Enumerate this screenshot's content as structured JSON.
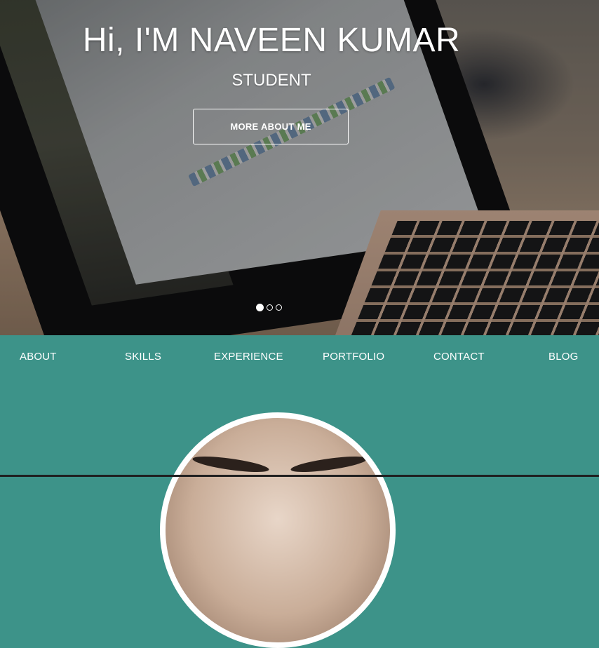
{
  "hero": {
    "title": "Hi, I'M NAVEEN KUMAR",
    "subtitle": "STUDENT",
    "button_label": "MORE ABOUT ME",
    "slides": {
      "count": 3,
      "active": 1
    }
  },
  "nav": {
    "items": [
      "ABOUT",
      "SKILLS",
      "EXPERIENCE",
      "PORTFOLIO",
      "CONTACT",
      "BLOG"
    ]
  },
  "colors": {
    "nav_background": "#3d9389",
    "text": "#ffffff"
  }
}
